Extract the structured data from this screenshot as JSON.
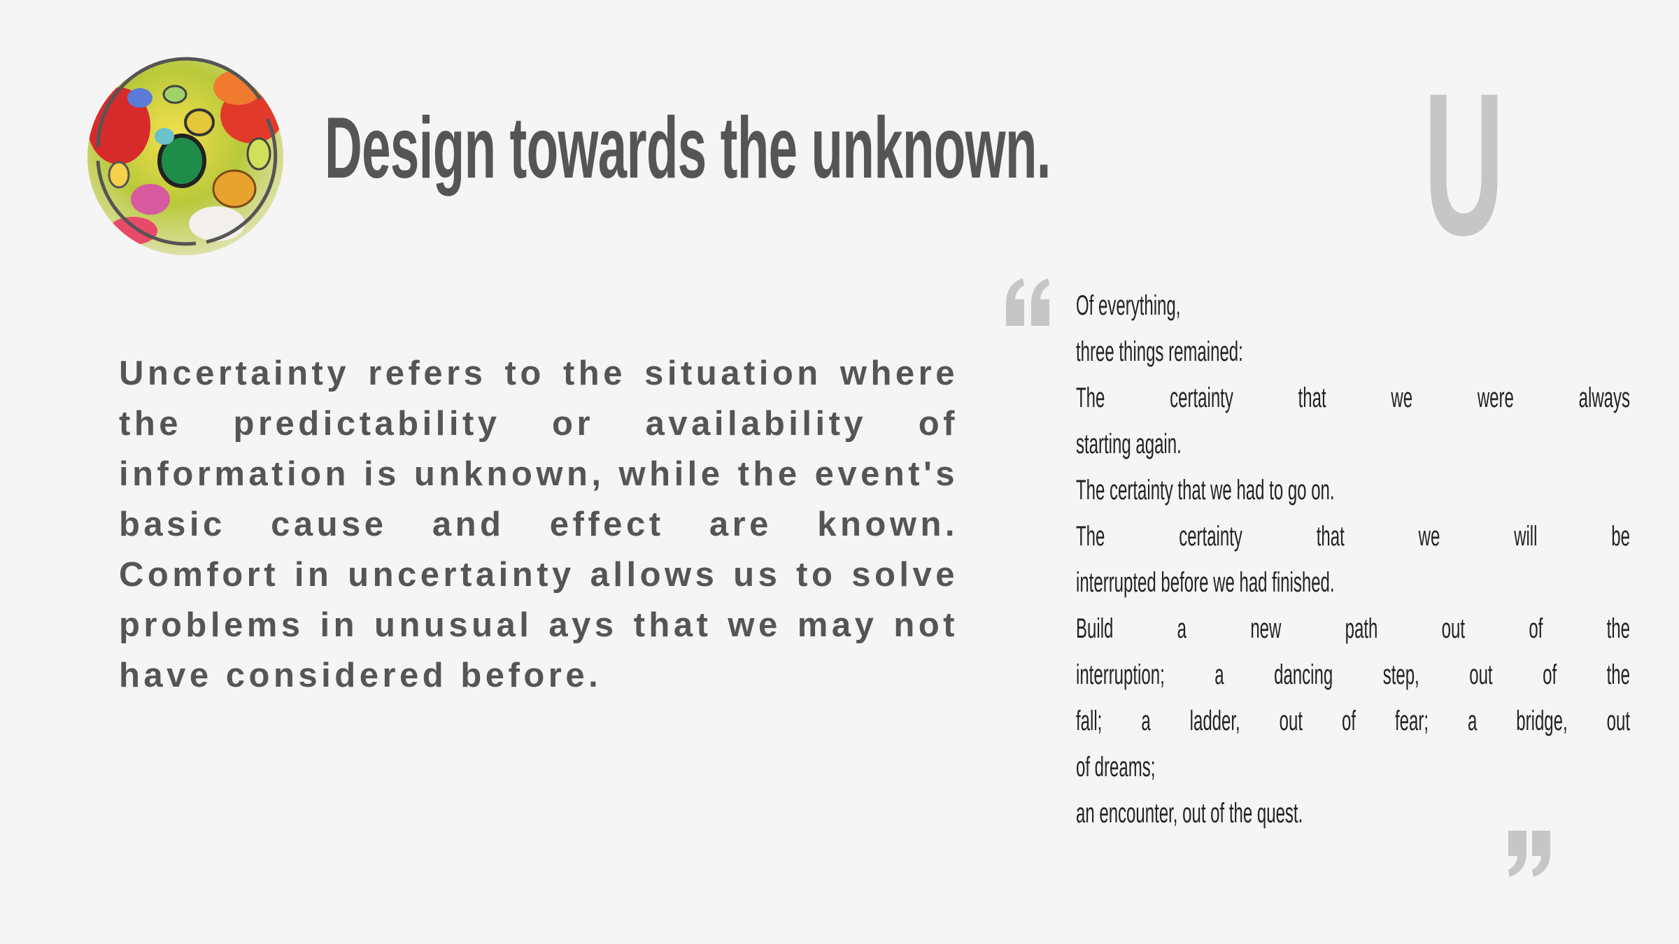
{
  "header": {
    "title": "Design towards the unknown.",
    "decor_letter": "U"
  },
  "logo": {
    "description_icon": "marbled-paint-circle-icon"
  },
  "body": {
    "paragraph": "Uncertainty refers to the situation where the predictability or availability of information is unknown, while the event's basic cause and effect are known. Comfort in uncertainty allows us to solve problems in unusual ays that we may not have considered before."
  },
  "quote": {
    "lines": [
      "Of everything,",
      "three things remained:",
      "The certainty that we were always",
      "starting again.",
      "The certainty that we had to go on.",
      "The certainty that we will be",
      "interrupted before we had finished.",
      "Build a new path out of the",
      "interruption; a dancing step, out of the",
      "fall; a ladder, out of fear; a bridge, out",
      "of dreams;",
      "an encounter, out of the quest."
    ]
  },
  "colors": {
    "background": "#f5f5f5",
    "title": "#555555",
    "accent_gray": "#c6c6c6",
    "quote_text": "#222222"
  }
}
